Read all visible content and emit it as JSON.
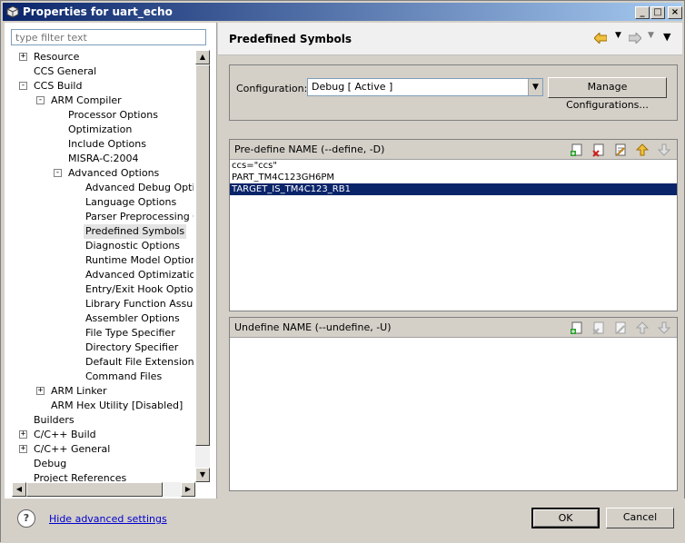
{
  "window": {
    "title": "Properties for uart_echo"
  },
  "filter": {
    "placeholder": "type filter text"
  },
  "tree": [
    {
      "label": "Resource",
      "expander": "+"
    },
    {
      "label": "CCS General"
    },
    {
      "label": "CCS Build",
      "expander": "−"
    },
    {
      "label": "ARM Compiler",
      "expander": "−"
    },
    {
      "label": "Processor Options"
    },
    {
      "label": "Optimization"
    },
    {
      "label": "Include Options"
    },
    {
      "label": "MISRA-C:2004"
    },
    {
      "label": "Advanced Options",
      "expander": "−"
    },
    {
      "label": "Advanced Debug Options"
    },
    {
      "label": "Language Options"
    },
    {
      "label": "Parser Preprocessing Opt"
    },
    {
      "label": "Predefined Symbols",
      "selected": true
    },
    {
      "label": "Diagnostic Options"
    },
    {
      "label": "Runtime Model Options"
    },
    {
      "label": "Advanced Optimizations"
    },
    {
      "label": "Entry/Exit Hook Options"
    },
    {
      "label": "Library Function Assumpt"
    },
    {
      "label": "Assembler Options"
    },
    {
      "label": "File Type Specifier"
    },
    {
      "label": "Directory Specifier"
    },
    {
      "label": "Default File Extensions"
    },
    {
      "label": "Command Files"
    },
    {
      "label": "ARM Linker",
      "expander": "+"
    },
    {
      "label": "ARM Hex Utility  [Disabled]"
    },
    {
      "label": "Builders"
    },
    {
      "label": "C/C++ Build",
      "expander": "+"
    },
    {
      "label": "C/C++ General",
      "expander": "+"
    },
    {
      "label": "Debug"
    },
    {
      "label": "Project References"
    }
  ],
  "page": {
    "title": "Predefined Symbols"
  },
  "config": {
    "label": "Configuration:",
    "value": "Debug  [ Active ]",
    "manage_label": "Manage Configurations..."
  },
  "predefine": {
    "title": "Pre-define NAME (--define, -D)",
    "items": [
      "ccs=\"ccs\"",
      "PART_TM4C123GH6PM",
      "TARGET_IS_TM4C123_RB1"
    ],
    "selected_index": 2
  },
  "undefine": {
    "title": "Undefine NAME (--undefine, -U)",
    "items": []
  },
  "footer": {
    "help_link": "Hide advanced settings",
    "ok_label": "OK",
    "cancel_label": "Cancel"
  },
  "colors": {
    "selection": "#0a246a",
    "titlebar": "#0a246a",
    "link": "#0000cc"
  }
}
